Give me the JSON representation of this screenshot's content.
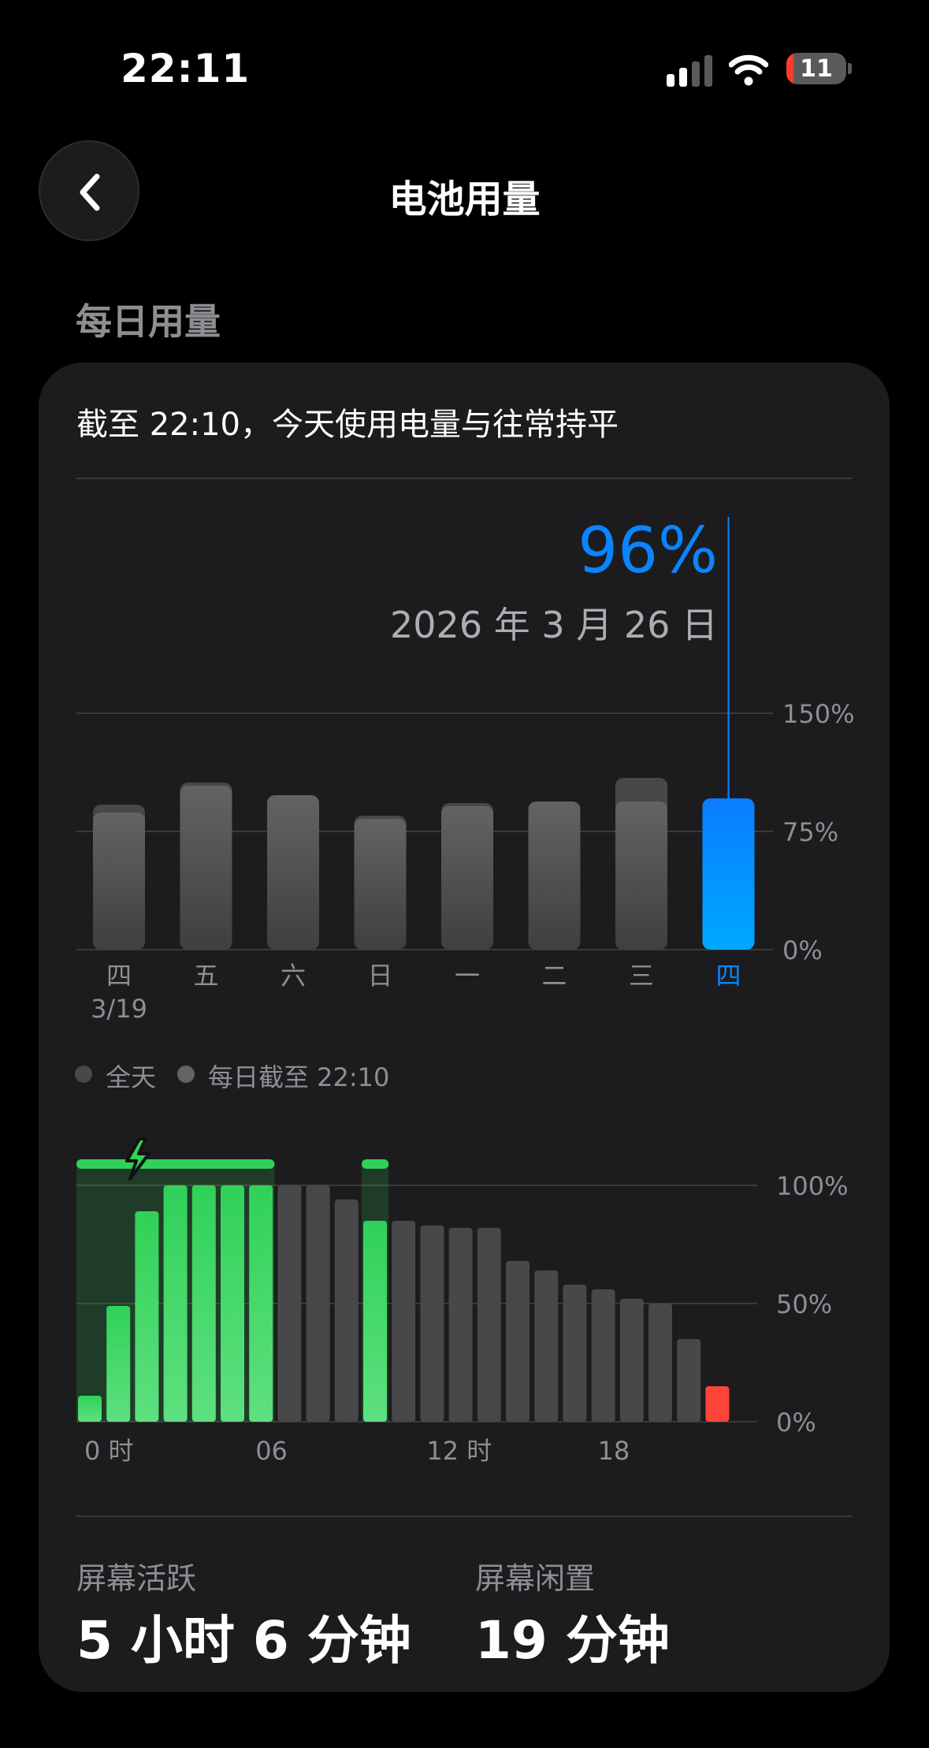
{
  "status_bar": {
    "time": "22:11",
    "battery_level": "11"
  },
  "nav": {
    "title": "电池用量",
    "back_icon": "chevron-left-icon"
  },
  "section": {
    "title": "每日用量"
  },
  "card": {
    "summary": "截至 22:10，今天使用电量与往常持平"
  },
  "selected": {
    "value": "96%",
    "date": "2026 年 3 月 26 日"
  },
  "legend": [
    {
      "label": "全天",
      "color": "#48484a"
    },
    {
      "label": "每日截至 22:10",
      "color": "#636366"
    }
  ],
  "chart_data": [
    {
      "type": "bar",
      "categories": [
        "四",
        "五",
        "六",
        "日",
        "一",
        "二",
        "三",
        "四"
      ],
      "first_date": "3/19",
      "series": [
        {
          "name": "全天",
          "values": [
            92,
            106,
            98,
            85,
            93,
            94,
            109,
            96
          ]
        },
        {
          "name": "每日截至 22:10",
          "values": [
            87,
            104,
            98,
            83,
            91,
            94,
            94,
            96
          ]
        }
      ],
      "selected_index": 7,
      "yticks": [
        "150%",
        "75%",
        "0%"
      ],
      "ylim": [
        0,
        150
      ],
      "colors": {
        "bar": "#5c5c5e",
        "selected": "#0a84ff"
      }
    },
    {
      "type": "bar",
      "x_ticks": [
        "0 时",
        "06",
        "12 时",
        "18"
      ],
      "yticks": [
        "100%",
        "50%",
        "0%"
      ],
      "ylim": [
        0,
        100
      ],
      "hourly_levels": [
        11,
        49,
        89,
        100,
        100,
        100,
        100,
        100,
        100,
        94,
        85,
        85,
        83,
        82,
        82,
        68,
        64,
        58,
        56,
        52,
        50,
        35,
        15
      ],
      "charging_hours": [
        0,
        1,
        2,
        3,
        4,
        5,
        6,
        10
      ],
      "charging_indicator_icon": "lightning-bolt-icon",
      "colors": {
        "charging": "#30d158",
        "discharge": "#48484a",
        "low": "#ff453a"
      }
    }
  ],
  "stats": [
    {
      "label": "屏幕活跃",
      "value": "5 小时 6 分钟"
    },
    {
      "label": "屏幕闲置",
      "value": "19 分钟"
    }
  ]
}
